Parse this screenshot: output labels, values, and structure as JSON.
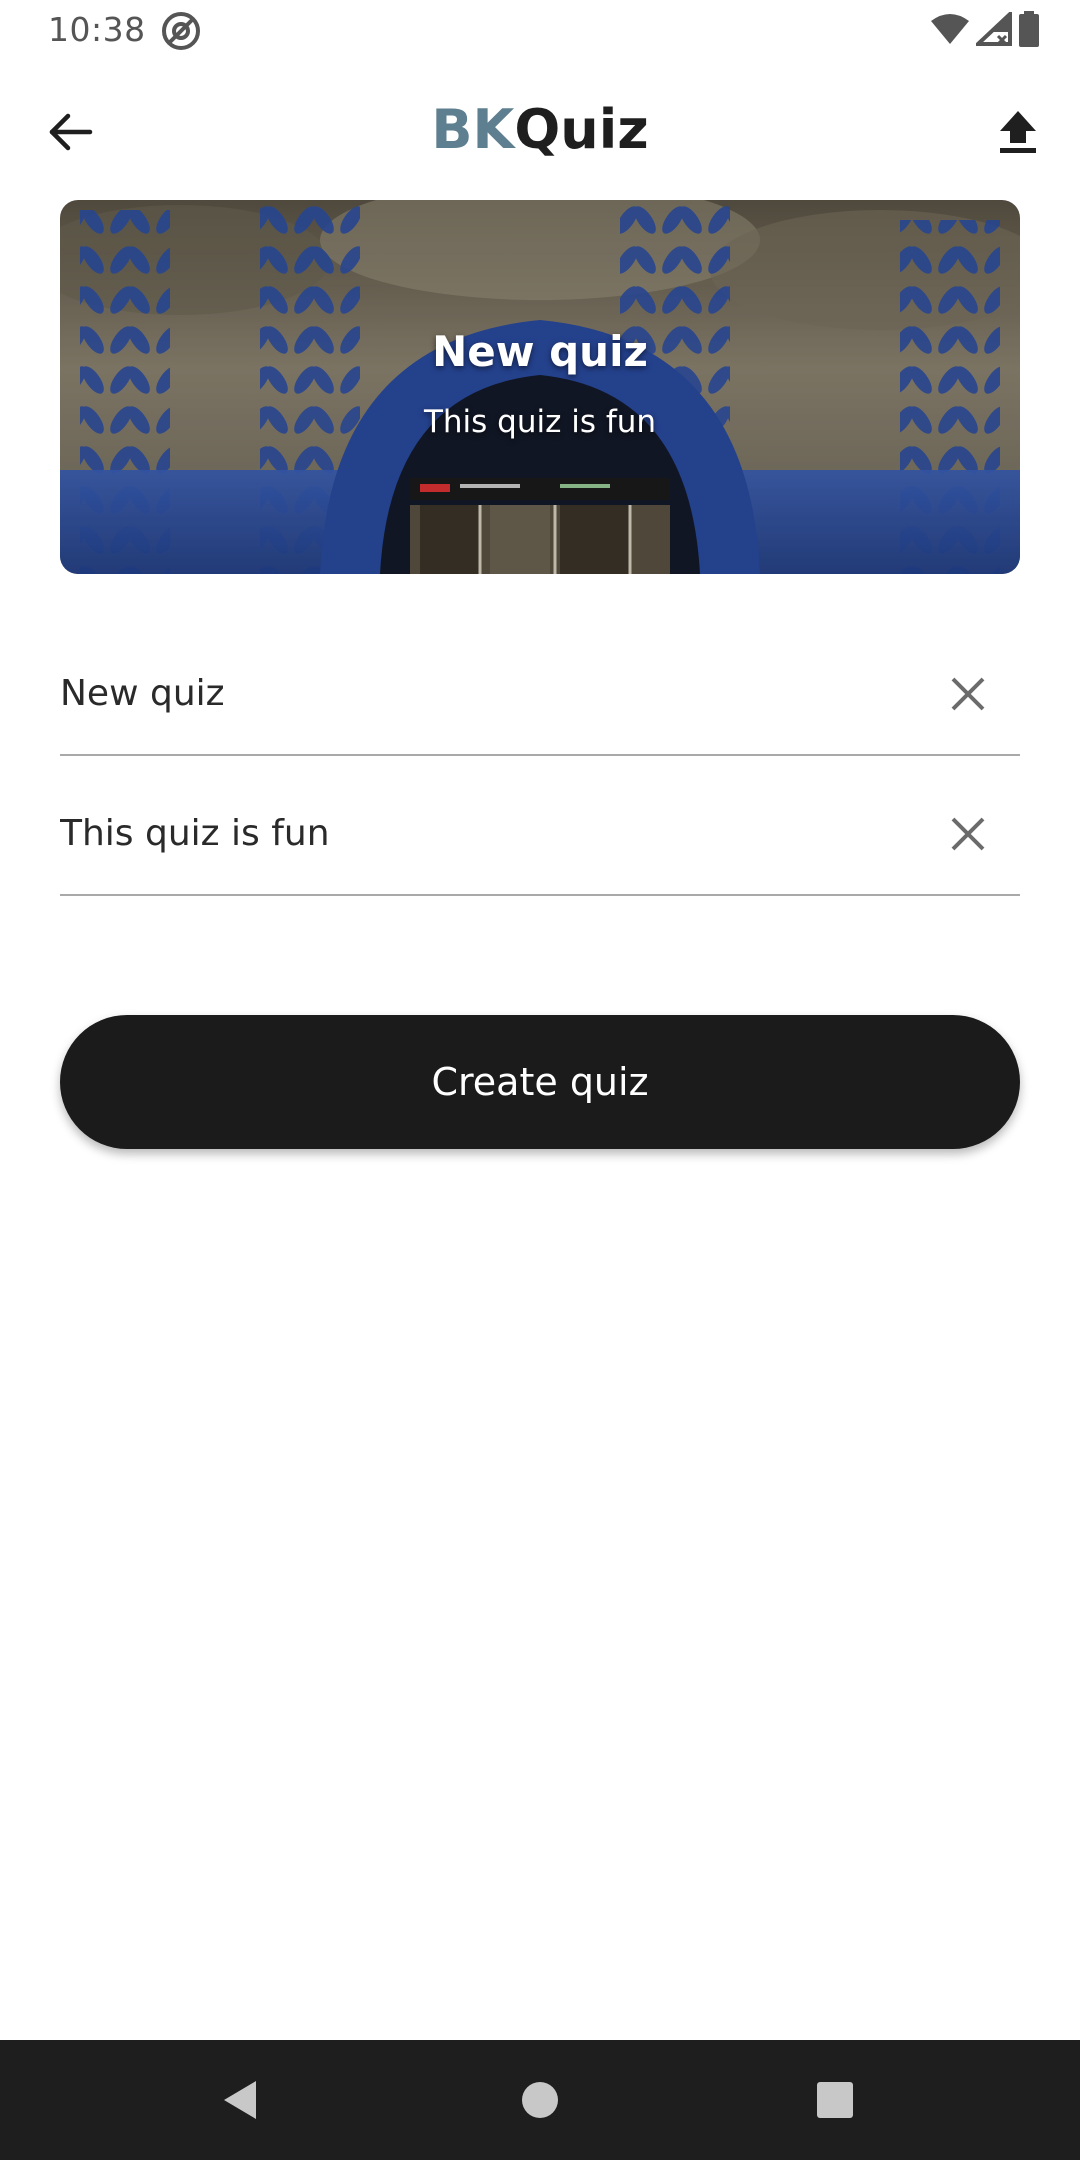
{
  "status_bar": {
    "time": "10:38",
    "icons": [
      "at-sign-icon",
      "wifi-icon",
      "signal-icon",
      "battery-icon"
    ]
  },
  "app_bar": {
    "title_prefix": "BK",
    "title_suffix": "Quiz",
    "back_icon": "arrow-left-icon",
    "upload_icon": "upload-icon"
  },
  "hero": {
    "title": "New quiz",
    "subtitle": "This quiz is fun"
  },
  "form": {
    "title_value": "New quiz",
    "description_value": "This quiz is fun",
    "clear_icon": "close-icon"
  },
  "create_button": {
    "label": "Create quiz"
  },
  "navigation": {
    "icons": [
      "nav-back-icon",
      "nav-home-icon",
      "nav-recents-icon"
    ]
  },
  "colors": {
    "brand_bk": "#5e7f8f",
    "primary_button": "#1b1b1b",
    "nav_bar": "#1e1e1e"
  }
}
